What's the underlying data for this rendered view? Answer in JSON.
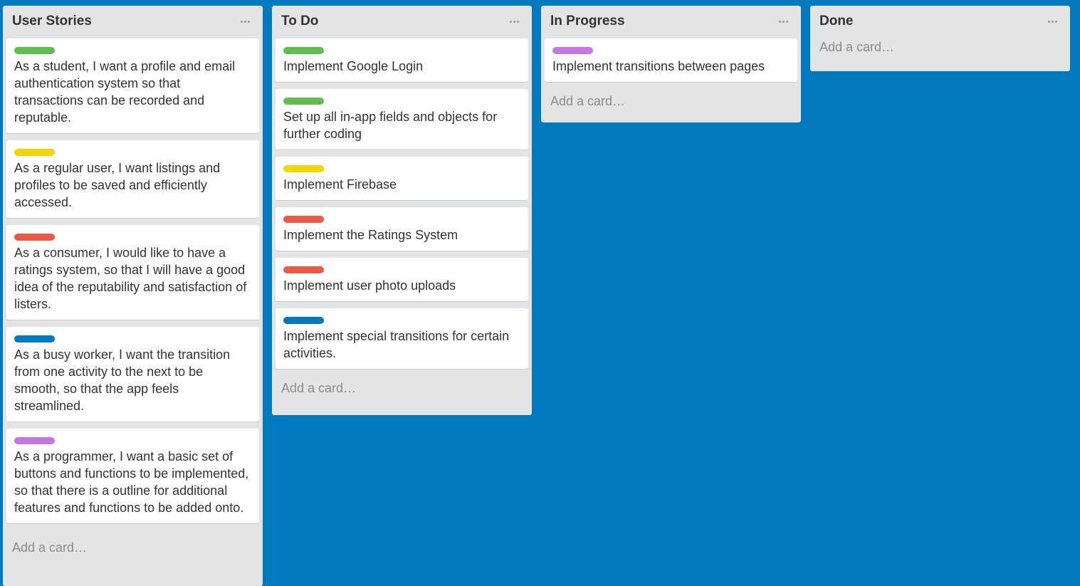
{
  "colors": {
    "green": "#61bd4f",
    "yellow": "#f2d600",
    "red": "#eb5a46",
    "blue": "#0079bf",
    "purple": "#c377e0"
  },
  "lists": [
    {
      "title": "User Stories",
      "add_card": "Add a card…",
      "cards": [
        {
          "label": "green",
          "text": "As a student, I want a profile and email authentication system so that transactions can be recorded and reputable."
        },
        {
          "label": "yellow",
          "text": "As a regular user, I want listings and profiles to be saved and efficiently accessed."
        },
        {
          "label": "red",
          "text": "As a consumer, I would like to have a ratings system, so that I will have a good idea of the reputability and satisfaction of listers."
        },
        {
          "label": "blue",
          "text": "As a busy worker, I want the transition from one activity to the next to be smooth, so that the app feels streamlined."
        },
        {
          "label": "purple",
          "text": "As a programmer, I want a basic set of buttons and functions to be implemented, so that there is a outline for additional features and functions to be added onto."
        }
      ]
    },
    {
      "title": "To Do",
      "add_card": "Add a card…",
      "cards": [
        {
          "label": "green",
          "text": "Implement Google Login"
        },
        {
          "label": "green",
          "text": "Set up all in-app fields and objects for further coding"
        },
        {
          "label": "yellow",
          "text": "Implement Firebase"
        },
        {
          "label": "red",
          "text": "Implement the Ratings System"
        },
        {
          "label": "red",
          "text": "Implement user photo uploads"
        },
        {
          "label": "blue",
          "text": "Implement special transitions for certain activities."
        }
      ]
    },
    {
      "title": "In Progress",
      "add_card": "Add a card…",
      "cards": [
        {
          "label": "purple",
          "text": "Implement transitions between pages"
        }
      ]
    },
    {
      "title": "Done",
      "add_card": "Add a card…",
      "cards": []
    }
  ]
}
